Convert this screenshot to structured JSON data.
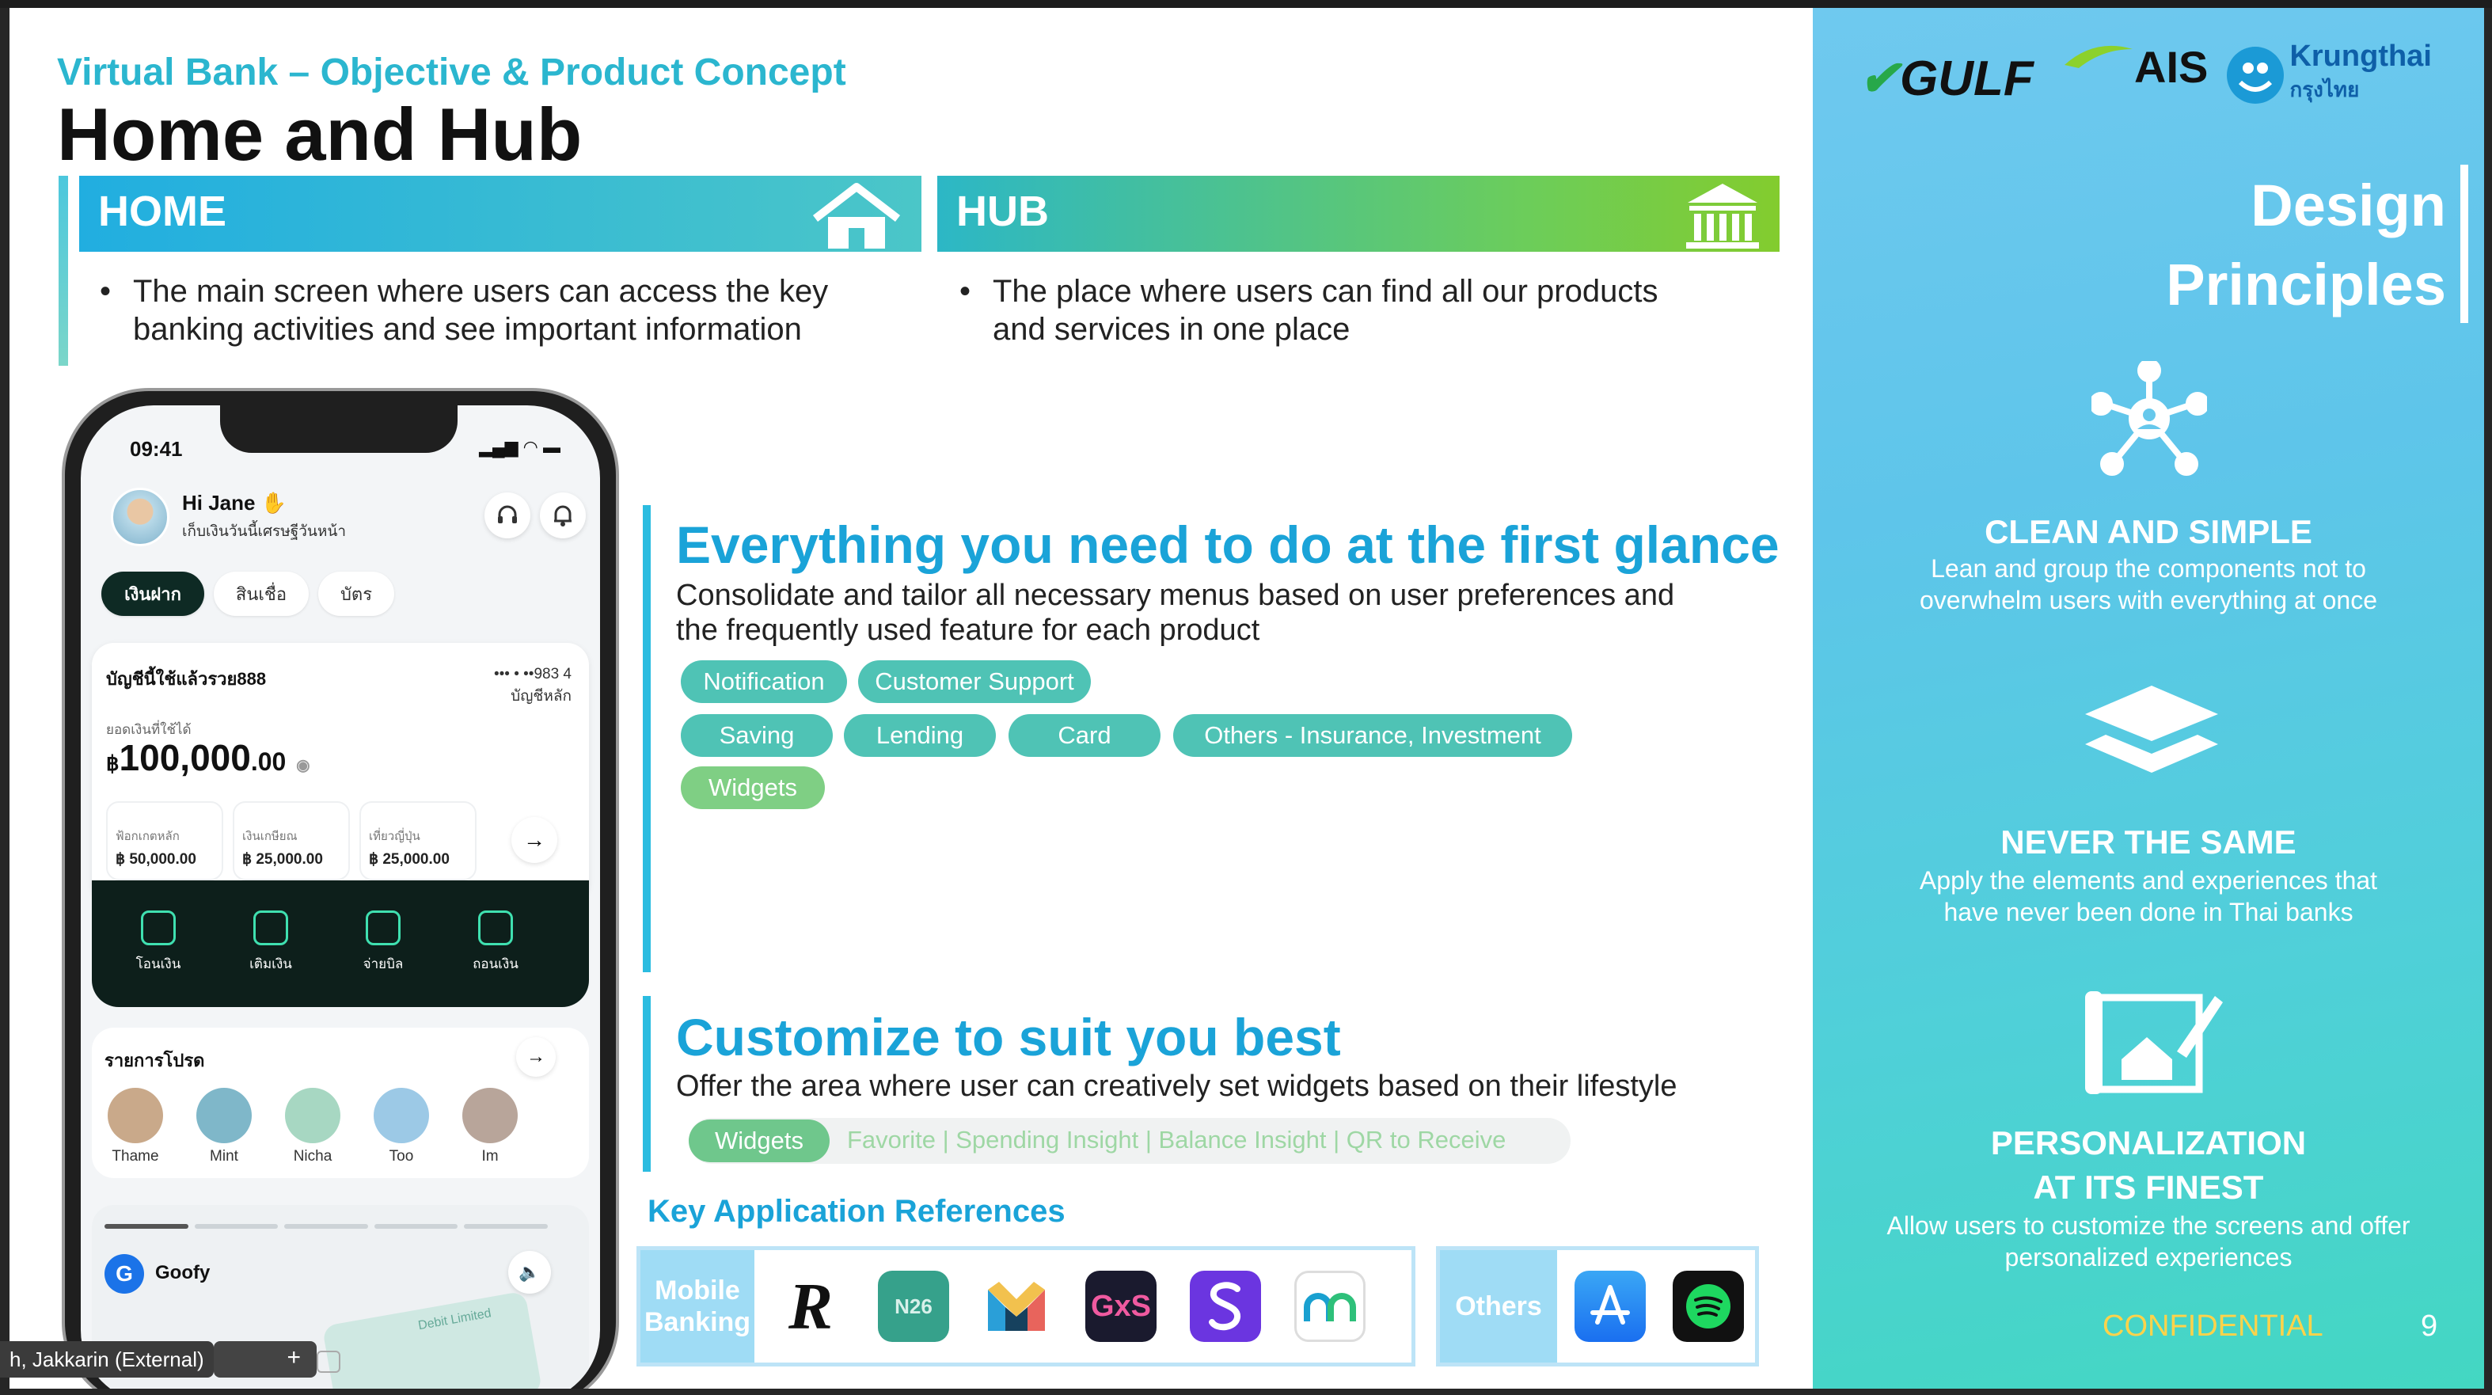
{
  "slide": {
    "subtitle": "Virtual Bank – Objective & Product Concept",
    "title": "Home and Hub",
    "home": {
      "label": "HOME",
      "desc_line1": "The main screen where users can access the key",
      "desc_line2": "banking activities and see important information"
    },
    "hub": {
      "label": "HUB",
      "desc_line1": "The place where users can find all our products",
      "desc_line2": "and services in one place"
    },
    "section1": {
      "heading": "Everything you need to do at the first glance",
      "text_line1": "Consolidate and tailor all necessary menus based on user preferences and",
      "text_line2": "the frequently used feature for each product",
      "pills": [
        "Notification",
        "Customer Support",
        "Saving",
        "Lending",
        "Card",
        "Others  - Insurance, Investment",
        "Widgets"
      ]
    },
    "section2": {
      "heading": "Customize to suit you best",
      "text": "Offer the area where user can creatively set widgets based on their lifestyle",
      "widget_pill": "Widgets",
      "widget_items": "Favorite  |  Spending Insight  |  Balance Insight  |  QR to Receive"
    },
    "references": {
      "heading": "Key Application References",
      "mobile_label_1": "Mobile",
      "mobile_label_2": "Banking",
      "others_label": "Others",
      "logos": {
        "revolut": "R",
        "n26": "N26",
        "gxs": "GxS"
      }
    }
  },
  "phone": {
    "time": "09:41",
    "greeting": "Hi Jane",
    "greeting_sub": "เก็บเงินวันนี้เศรษฐีวันหน้า",
    "tabs": [
      "เงินฝาก",
      "สินเชื่อ",
      "บัตร"
    ],
    "account_title": "บัญชีนี้ใช้แล้วรวย888",
    "account_number": "•••  •  ••983  4",
    "account_type": "บัญชีหลัก",
    "balance_label": "ยอดเงินที่ใช้ได้",
    "balance_currency": "฿",
    "balance_value": "100,000",
    "balance_decimal": ".00",
    "pockets": [
      {
        "label": "ฟ้อกเกตหลัก",
        "value": "฿ 50,000.00"
      },
      {
        "label": "เงินเกษียณ",
        "value": "฿ 25,000.00"
      },
      {
        "label": "เที่ยวญี่ปุ่น",
        "value": "฿ 25,000.00"
      }
    ],
    "actions": [
      "โอนเงิน",
      "เติมเงิน",
      "จ่ายบิล",
      "ถอนเงิน"
    ],
    "favorites_title": "รายการโปรด",
    "favorites": [
      "Thame",
      "Mint",
      "Nicha",
      "Too",
      "Im"
    ],
    "goofy_badge": "G",
    "goofy_name": "Goofy",
    "card_text": "Debit Limited"
  },
  "panel": {
    "brands": {
      "gulf": "GULF",
      "ais": "AIS",
      "krungthai": "Krungthai",
      "krungthai_th": "กรุงไทย"
    },
    "title_line1": "Design",
    "title_line2": "Principles",
    "principles": [
      {
        "title": "CLEAN AND SIMPLE",
        "desc_line1": "Lean and group the components not to",
        "desc_line2": "overwhelm users with everything at once"
      },
      {
        "title": "NEVER THE SAME",
        "desc_line1": "Apply the elements and experiences that",
        "desc_line2": "have never been done in Thai banks"
      },
      {
        "title_line1": "PERSONALIZATION",
        "title_line2": "AT ITS FINEST",
        "desc_line1": "Allow users to customize the screens and offer",
        "desc_line2": "personalized experiences"
      }
    ],
    "confidential": "CONFIDENTIAL",
    "page_number": "9"
  },
  "overlay": {
    "participant": "h, Jakkarin (External)",
    "plus": "+"
  }
}
